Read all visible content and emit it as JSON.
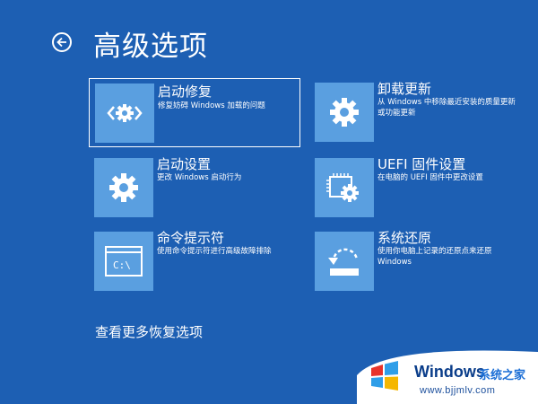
{
  "page": {
    "title": "高级选项",
    "more_link": "查看更多恢复选项"
  },
  "options": [
    {
      "id": "startup-repair",
      "title": "启动修复",
      "desc": "修复妨碍 Windows 加载的问题",
      "icon": "code-gear-icon",
      "selected": true
    },
    {
      "id": "uninstall-updates",
      "title": "卸载更新",
      "desc": "从 Windows 中移除最近安装的质量更新或功能更新",
      "icon": "gear-icon",
      "selected": false
    },
    {
      "id": "startup-settings",
      "title": "启动设置",
      "desc": "更改 Windows 启动行为",
      "icon": "gear-icon",
      "selected": false
    },
    {
      "id": "uefi-settings",
      "title": "UEFI 固件设置",
      "desc": "在电脑的 UEFI 固件中更改设置",
      "icon": "chip-gear-icon",
      "selected": false
    },
    {
      "id": "command-prompt",
      "title": "命令提示符",
      "desc": "使用命令提示符进行高级故障排除",
      "icon": "command-prompt-icon",
      "selected": false
    },
    {
      "id": "system-restore",
      "title": "系统还原",
      "desc": "使用你电脑上记录的还原点来还原 Windows",
      "icon": "restore-icon",
      "selected": false
    }
  ],
  "console_text": "C:\\",
  "watermark": {
    "brand": "Windows",
    "sub": "系统之家",
    "url": "www.bjjmlv.com"
  },
  "colors": {
    "background": "#1d5fb3",
    "tile": "#5a9fe0",
    "text": "#ffffff"
  }
}
